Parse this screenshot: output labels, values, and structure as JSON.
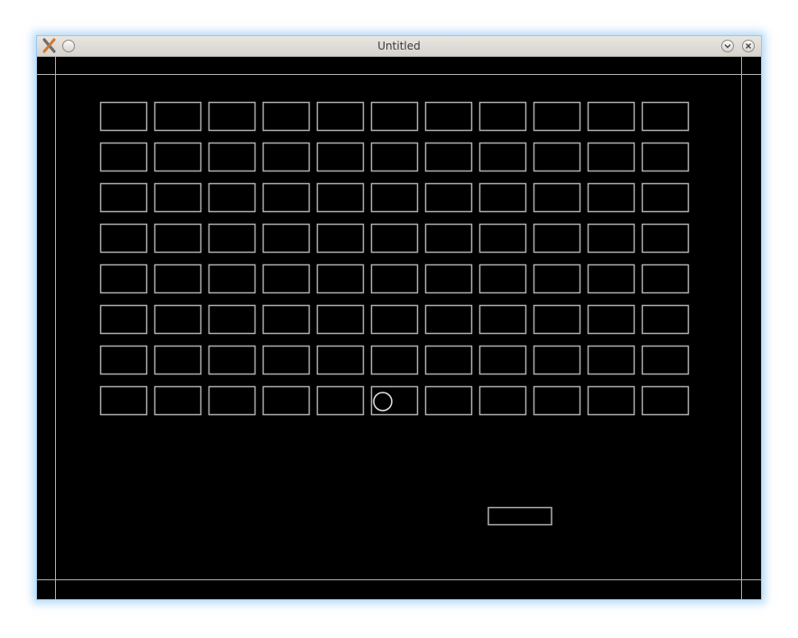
{
  "window": {
    "title": "Untitled",
    "titlebar_color": "#dcd9d5",
    "icons": {
      "app": "app-x-icon",
      "menu": "menu-dot-icon",
      "minimize": "chevron-down-icon",
      "close": "close-icon"
    }
  },
  "game": {
    "background_color": "#000000",
    "line_color": "#b0b0b0",
    "brick_grid": {
      "rows": 8,
      "columns": 11
    },
    "ball": {
      "row": 8,
      "column": 6
    },
    "paddle": {
      "visible": true
    }
  }
}
